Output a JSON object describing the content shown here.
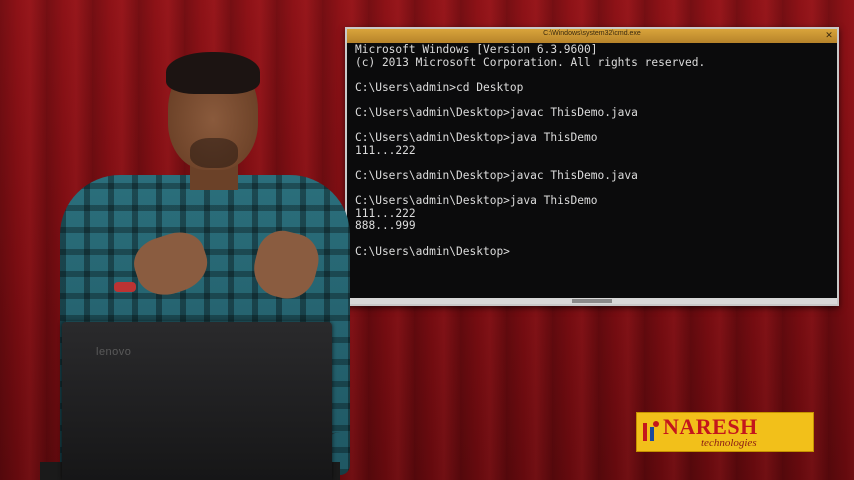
{
  "terminal": {
    "title": "C:\\Windows\\system32\\cmd.exe",
    "lines": [
      "Microsoft Windows [Version 6.3.9600]",
      "(c) 2013 Microsoft Corporation. All rights reserved.",
      "",
      "C:\\Users\\admin>cd Desktop",
      "",
      "C:\\Users\\admin\\Desktop>javac ThisDemo.java",
      "",
      "C:\\Users\\admin\\Desktop>java ThisDemo",
      "111...222",
      "",
      "C:\\Users\\admin\\Desktop>javac ThisDemo.java",
      "",
      "C:\\Users\\admin\\Desktop>java ThisDemo",
      "111...222",
      "888...999",
      "",
      "C:\\Users\\admin\\Desktop>"
    ]
  },
  "laptop": {
    "logo": "lenovo"
  },
  "brand": {
    "name": "NARESH",
    "subtitle": "technologies",
    "color": "#c4161c",
    "background": "#f2c01a"
  }
}
